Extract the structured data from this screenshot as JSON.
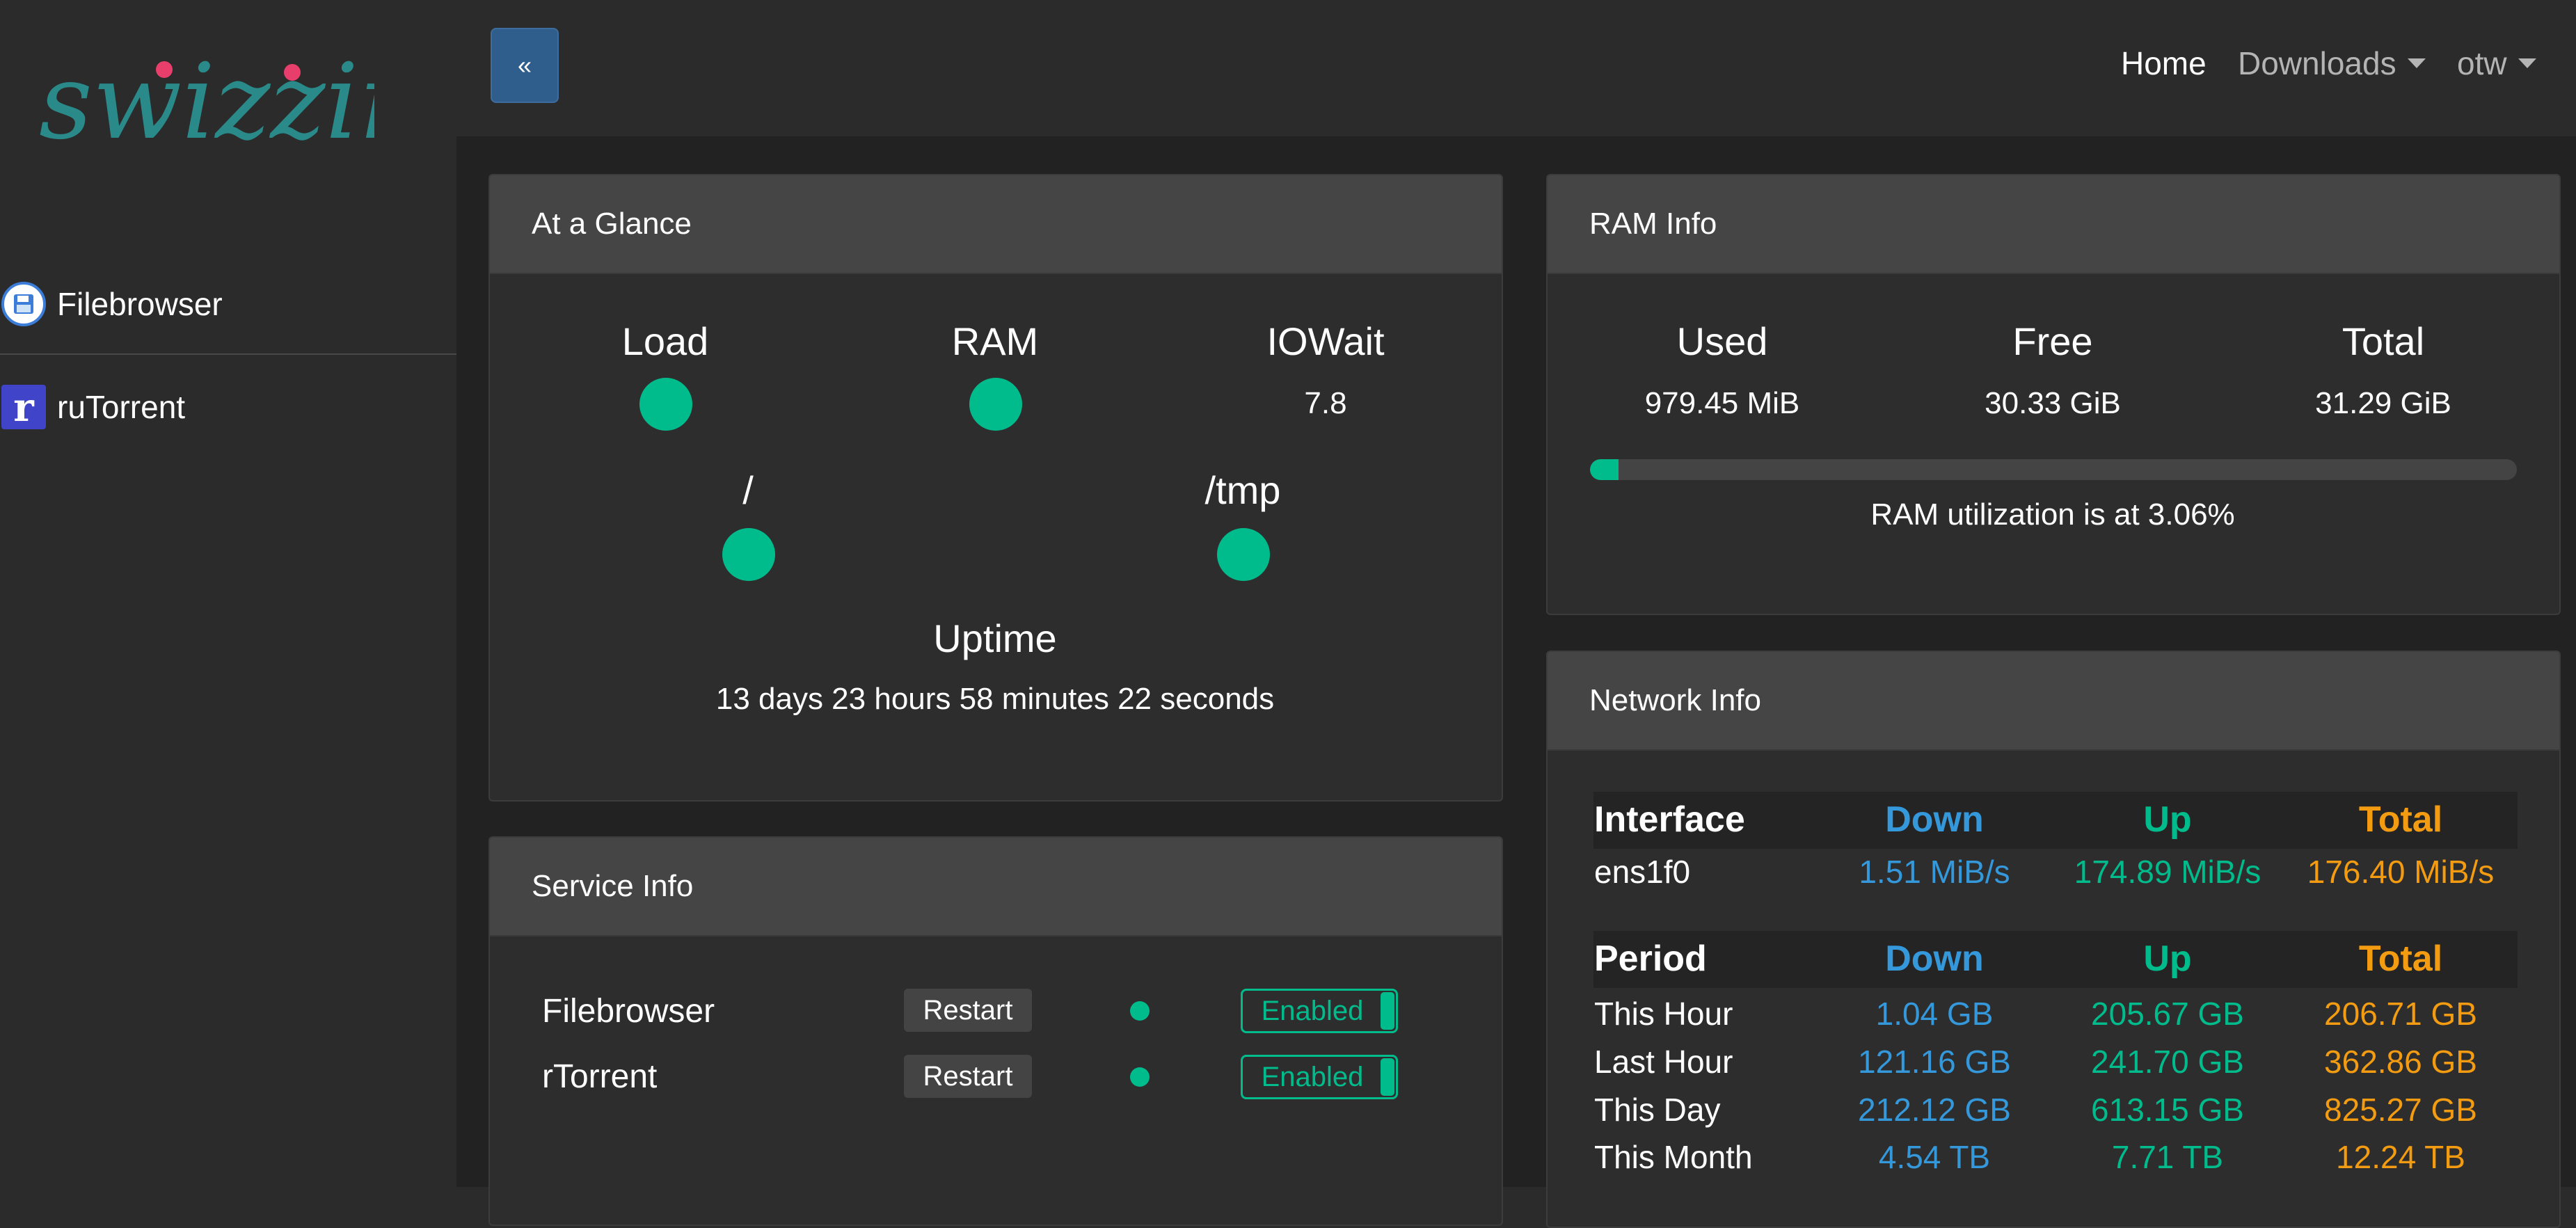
{
  "brand": {
    "logo_text": "swizzin",
    "logo_color": "#2a8a8a",
    "dot_color": "#e83e6c"
  },
  "sidebar": {
    "items": [
      {
        "label": "Filebrowser",
        "icon": "floppy-disk-icon"
      },
      {
        "label": "ruTorrent",
        "icon": "rutorrent-r-icon"
      }
    ]
  },
  "topbar": {
    "collapse_label": "«",
    "nav": {
      "home": "Home",
      "downloads": "Downloads",
      "user": "otw"
    }
  },
  "glance": {
    "title": "At a Glance",
    "load_label": "Load",
    "ram_label": "RAM",
    "iowait_label": "IOWait",
    "iowait_value": "7.8",
    "root_label": "/",
    "tmp_label": "/tmp",
    "uptime_label": "Uptime",
    "uptime_value": "13 days 23 hours 58 minutes 22 seconds"
  },
  "services": {
    "title": "Service Info",
    "restart_label": "Restart",
    "enabled_label": "Enabled",
    "items": [
      {
        "name": "Filebrowser"
      },
      {
        "name": "rTorrent"
      }
    ]
  },
  "ram": {
    "title": "RAM Info",
    "used_label": "Used",
    "used_value": "979.45 MiB",
    "free_label": "Free",
    "free_value": "30.33 GiB",
    "total_label": "Total",
    "total_value": "31.29 GiB",
    "utilization_percent": 3.06,
    "utilization_text": "RAM utilization is at 3.06%"
  },
  "network": {
    "title": "Network Info",
    "interface_header": "Interface",
    "down_header": "Down",
    "up_header": "Up",
    "total_header": "Total",
    "interface": {
      "name": "ens1f0",
      "down": "1.51 MiB/s",
      "up": "174.89 MiB/s",
      "total": "176.40 MiB/s"
    },
    "period_header": "Period",
    "periods": [
      {
        "label": "This Hour",
        "down": "1.04 GB",
        "up": "205.67 GB",
        "total": "206.71 GB"
      },
      {
        "label": "Last Hour",
        "down": "121.16 GB",
        "up": "241.70 GB",
        "total": "362.86 GB"
      },
      {
        "label": "This Day",
        "down": "212.12 GB",
        "up": "613.15 GB",
        "total": "825.27 GB"
      },
      {
        "label": "This Month",
        "down": "4.54 TB",
        "up": "7.71 TB",
        "total": "12.24 TB"
      }
    ]
  },
  "colors": {
    "accent": "#00bc8c",
    "down": "#3498db",
    "total": "#f39c12",
    "primary_button": "#2f5d8c"
  }
}
